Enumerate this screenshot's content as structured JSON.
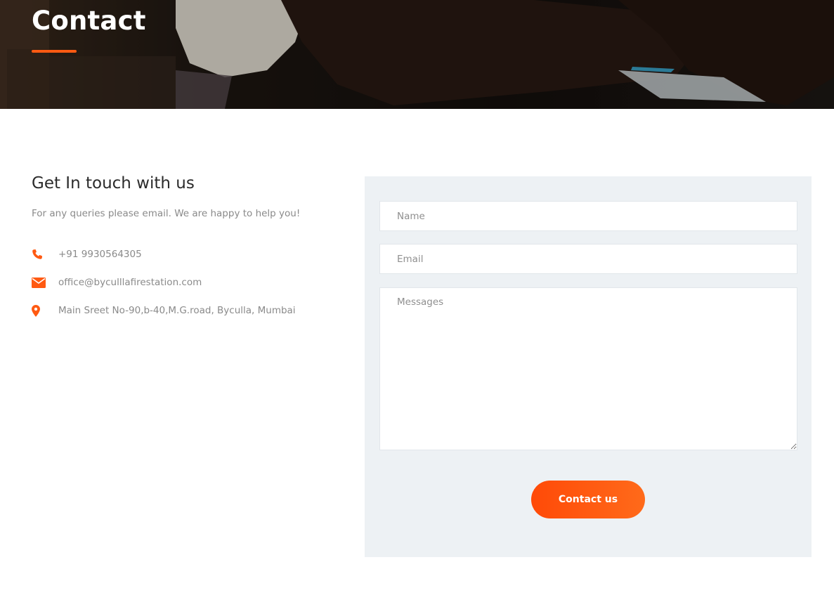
{
  "hero": {
    "title": "Contact"
  },
  "info": {
    "heading": "Get In touch with us",
    "subtitle": "For any queries please email. We are happy to help you!",
    "items": [
      {
        "icon": "phone-icon",
        "text": "+91 9930564305"
      },
      {
        "icon": "envelope-icon",
        "text": "office@byculllafirestation.com"
      },
      {
        "icon": "map-pin-icon",
        "text": "Main Sreet No-90,b-40,M.G.road, Byculla, Mumbai"
      }
    ]
  },
  "form": {
    "name_placeholder": "Name",
    "email_placeholder": "Email",
    "message_placeholder": "Messages",
    "submit_label": "Contact us"
  },
  "colors": {
    "accent": "#ff5a12",
    "panel_bg": "#edf1f4",
    "text_muted": "#8a8a8a"
  }
}
